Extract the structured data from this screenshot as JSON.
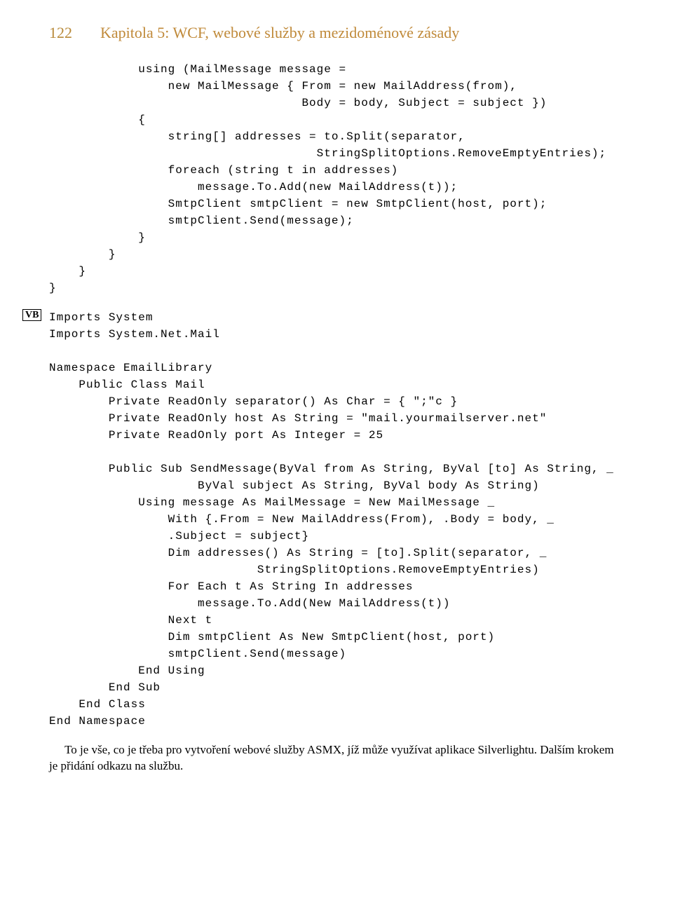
{
  "header": {
    "pageNumber": "122",
    "chapterTitle": "Kapitola 5: WCF, webové služby a mezidoménové zásady"
  },
  "csharpCode": "            using (MailMessage message =\n                new MailMessage { From = new MailAddress(from),\n                                  Body = body, Subject = subject })\n            {\n                string[] addresses = to.Split(separator,\n                                    StringSplitOptions.RemoveEmptyEntries);\n                foreach (string t in addresses)\n                    message.To.Add(new MailAddress(t));\n                SmtpClient smtpClient = new SmtpClient(host, port);\n                smtpClient.Send(message);\n            }\n        }\n    }\n}",
  "vbBadge": "VB",
  "vbCode": "Imports System\nImports System.Net.Mail\n\nNamespace EmailLibrary\n    Public Class Mail\n        Private ReadOnly separator() As Char = { \";\"c }\n        Private ReadOnly host As String = \"mail.yourmailserver.net\"\n        Private ReadOnly port As Integer = 25\n\n        Public Sub SendMessage(ByVal from As String, ByVal [to] As String, _\n                    ByVal subject As String, ByVal body As String)\n            Using message As MailMessage = New MailMessage _\n                With {.From = New MailAddress(From), .Body = body, _\n                .Subject = subject}\n                Dim addresses() As String = [to].Split(separator, _\n                            StringSplitOptions.RemoveEmptyEntries)\n                For Each t As String In addresses\n                    message.To.Add(New MailAddress(t))\n                Next t\n                Dim smtpClient As New SmtpClient(host, port)\n                smtpClient.Send(message)\n            End Using\n        End Sub\n    End Class\nEnd Namespace",
  "bodyText": "To je vše, co je třeba pro vytvoření webové služby ASMX, jíž může využívat aplikace Silverlightu. Dalším krokem je přidání odkazu na službu."
}
